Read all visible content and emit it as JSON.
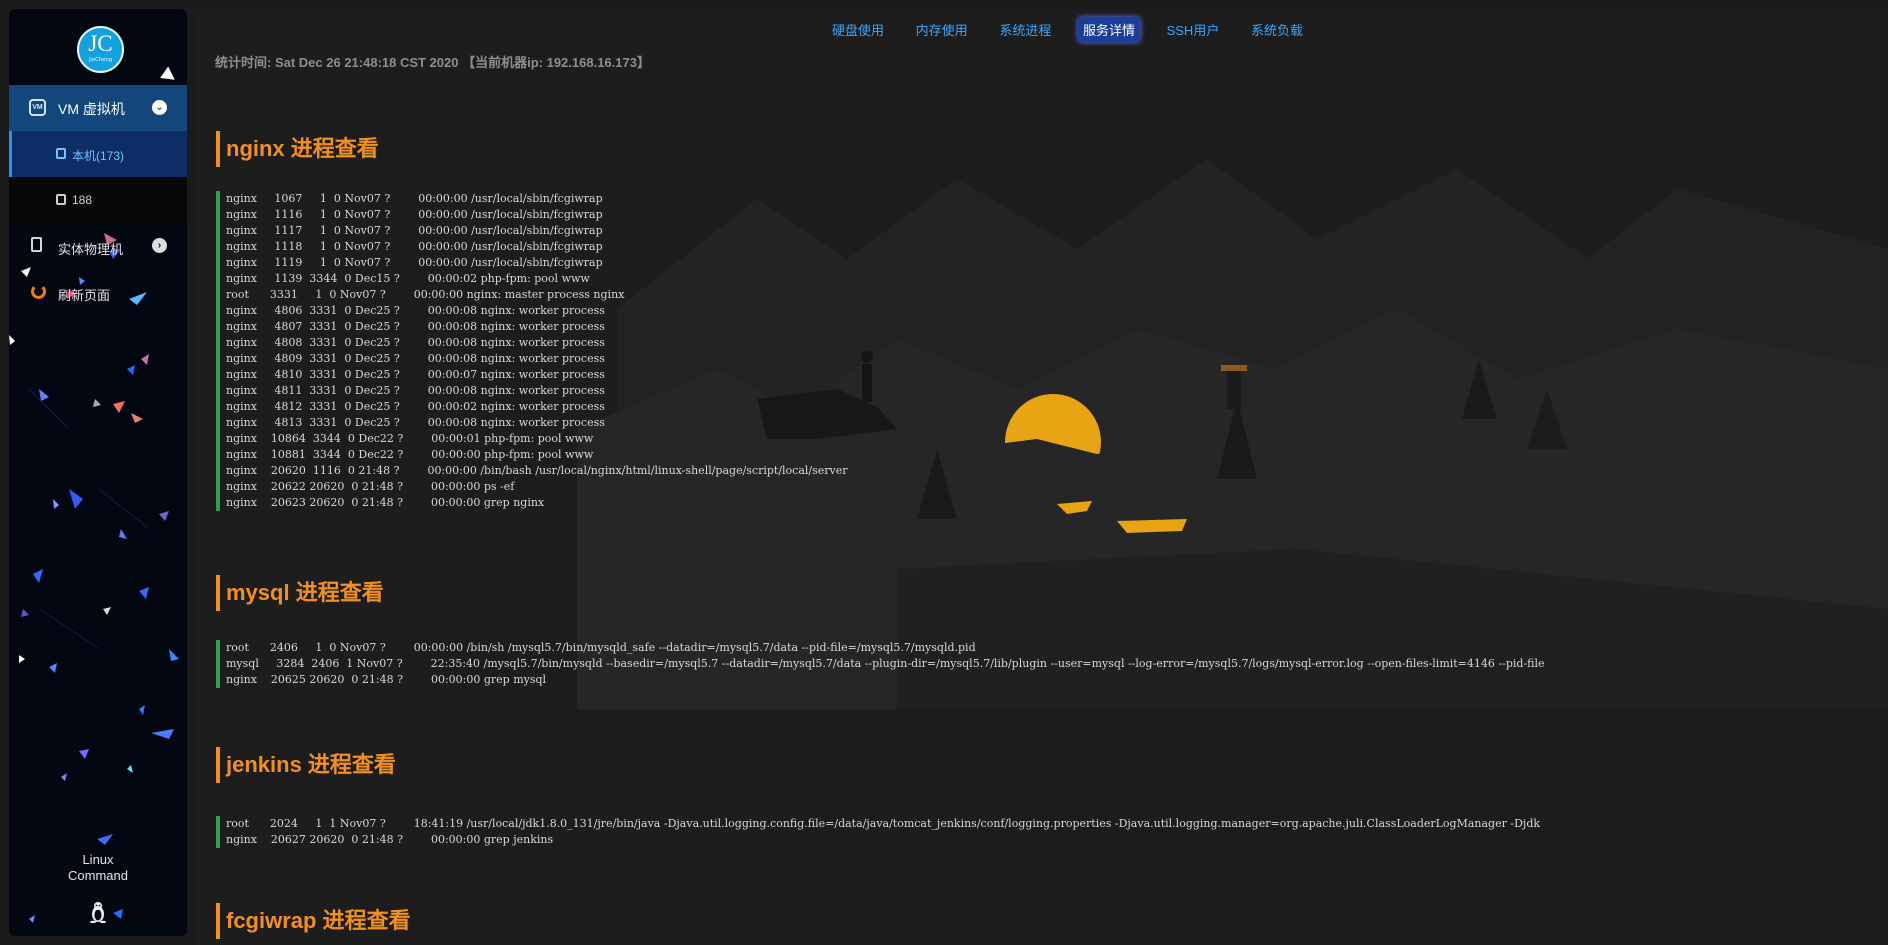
{
  "sidebar": {
    "logo_text": "JC",
    "logo_subtext": "jiaCheng",
    "vm_label": "VM 虚拟机",
    "vm_icon": "VM",
    "sub_items": [
      {
        "label": "本机(173)"
      },
      {
        "label": "188"
      }
    ],
    "physical_label": "实体物理机",
    "refresh_label": "刷新页面",
    "footer_line1": "Linux",
    "footer_line2": "Command"
  },
  "tabs": [
    {
      "label": "硬盘使用"
    },
    {
      "label": "内存使用"
    },
    {
      "label": "系统进程"
    },
    {
      "label": "服务详情"
    },
    {
      "label": "SSH用户"
    },
    {
      "label": "系统负载"
    }
  ],
  "active_tab": "服务详情",
  "stats": "统计时间: Sat Dec 26 21:48:18 CST 2020 【当前机器ip: 192.168.16.173】",
  "sections": [
    {
      "title": "nginx 进程查看",
      "lines": [
        "nginx     1067     1  0 Nov07 ?        00:00:00 /usr/local/sbin/fcgiwrap",
        "nginx     1116     1  0 Nov07 ?        00:00:00 /usr/local/sbin/fcgiwrap",
        "nginx     1117     1  0 Nov07 ?        00:00:00 /usr/local/sbin/fcgiwrap",
        "nginx     1118     1  0 Nov07 ?        00:00:00 /usr/local/sbin/fcgiwrap",
        "nginx     1119     1  0 Nov07 ?        00:00:00 /usr/local/sbin/fcgiwrap",
        "nginx     1139  3344  0 Dec15 ?        00:00:02 php-fpm: pool www",
        "root      3331     1  0 Nov07 ?        00:00:00 nginx: master process nginx",
        "nginx     4806  3331  0 Dec25 ?        00:00:08 nginx: worker process",
        "nginx     4807  3331  0 Dec25 ?        00:00:08 nginx: worker process",
        "nginx     4808  3331  0 Dec25 ?        00:00:08 nginx: worker process",
        "nginx     4809  3331  0 Dec25 ?        00:00:08 nginx: worker process",
        "nginx     4810  3331  0 Dec25 ?        00:00:07 nginx: worker process",
        "nginx     4811  3331  0 Dec25 ?        00:00:08 nginx: worker process",
        "nginx     4812  3331  0 Dec25 ?        00:00:02 nginx: worker process",
        "nginx     4813  3331  0 Dec25 ?        00:00:08 nginx: worker process",
        "nginx    10864  3344  0 Dec22 ?        00:00:01 php-fpm: pool www",
        "nginx    10881  3344  0 Dec22 ?        00:00:00 php-fpm: pool www",
        "nginx    20620  1116  0 21:48 ?        00:00:00 /bin/bash /usr/local/nginx/html/linux-shell/page/script/local/server",
        "nginx    20622 20620  0 21:48 ?        00:00:00 ps -ef",
        "nginx    20623 20620  0 21:48 ?        00:00:00 grep nginx"
      ]
    },
    {
      "title": "mysql 进程查看",
      "lines": [
        "root      2406     1  0 Nov07 ?        00:00:00 /bin/sh /mysql5.7/bin/mysqld_safe --datadir=/mysql5.7/data --pid-file=/mysql5.7/mysqld.pid",
        "mysql     3284  2406  1 Nov07 ?        22:35:40 /mysql5.7/bin/mysqld --basedir=/mysql5.7 --datadir=/mysql5.7/data --plugin-dir=/mysql5.7/lib/plugin --user=mysql --log-error=/mysql5.7/logs/mysql-error.log --open-files-limit=4146 --pid-file",
        "nginx    20625 20620  0 21:48 ?        00:00:00 grep mysql"
      ]
    },
    {
      "title": "jenkins 进程查看",
      "lines": [
        "root      2024     1  1 Nov07 ?        18:41:19 /usr/local/jdk1.8.0_131/jre/bin/java -Djava.util.logging.config.file=/data/java/tomcat_jenkins/conf/logging.properties -Djava.util.logging.manager=org.apache.juli.ClassLoaderLogManager -Djdk",
        "nginx    20627 20620  0 21:48 ?        00:00:00 grep jenkins"
      ]
    },
    {
      "title": "fcgiwrap 进程查看",
      "lines": []
    }
  ],
  "colors": {
    "accent_orange": "#f3901d",
    "tab_blue": "#35a7ff",
    "active_tab_bg": "#1c3d99",
    "ps_border_green": "#2da24a",
    "sidebar_active": "#13467a"
  },
  "icons": [
    "vm-icon",
    "chevron-down-icon",
    "server-icon",
    "calculator-icon",
    "chevron-right-icon",
    "power-icon",
    "linux-penguin-icon"
  ]
}
